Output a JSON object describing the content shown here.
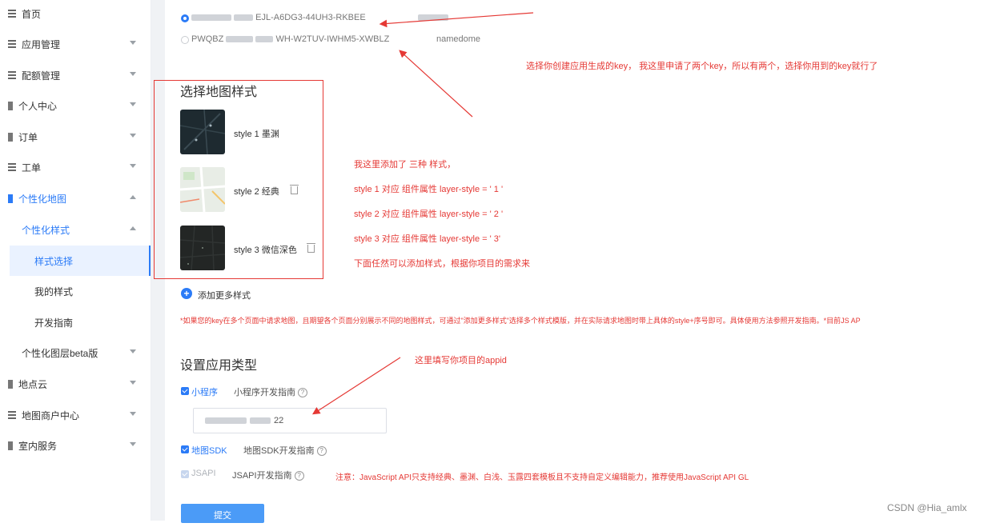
{
  "sidebar": {
    "items": [
      {
        "label": "首页"
      },
      {
        "label": "应用管理"
      },
      {
        "label": "配额管理"
      },
      {
        "label": "个人中心"
      },
      {
        "label": "订单"
      },
      {
        "label": "工单"
      },
      {
        "label": "个性化地图"
      },
      {
        "label": "个性化样式"
      },
      {
        "label": "样式选择"
      },
      {
        "label": "我的样式"
      },
      {
        "label": "开发指南"
      },
      {
        "label": "个性化图层beta版"
      },
      {
        "label": "地点云"
      },
      {
        "label": "地图商户中心"
      },
      {
        "label": "室内服务"
      }
    ]
  },
  "keys": [
    {
      "key_suffix": "EJL-A6DG3-44UH3-RKBEE",
      "name": "",
      "selected": true
    },
    {
      "key_prefix": "PWQBZ",
      "key_suffix": "WH-W2TUV-IWHM5-XWBLZ",
      "name": "namedome",
      "selected": false
    }
  ],
  "style_section": {
    "title": "选择地图样式",
    "styles": [
      {
        "label": "style 1 墨渊"
      },
      {
        "label": "style 2 经典"
      },
      {
        "label": "style 3 微信深色"
      }
    ],
    "add_more": "添加更多样式",
    "note": "*如果您的key在多个页面中请求地图，且期望各个页面分别展示不同的地图样式，可通过\"添加更多样式\"选择多个样式模版，并在实际请求地图时带上具体的style+序号即可。具体使用方法参照开发指南。*目前JS AP"
  },
  "app_type": {
    "title": "设置应用类型",
    "miniprogram": {
      "label": "小程序",
      "guide": "小程序开发指南",
      "appid_suffix": "22"
    },
    "sdk": {
      "label": "地图SDK",
      "guide": "地图SDK开发指南"
    },
    "jsapi": {
      "label": "JSAPI",
      "guide": "JSAPI开发指南"
    },
    "submit": "提交"
  },
  "annotations": {
    "key_note": "选择你创建应用生成的key， 我这里申请了两个key，所以有两个，选择你用到的key就行了",
    "style_note_1": "我这里添加了 三种 样式，",
    "style_note_2": "style 1    对应  组件属性     layer-style = ' 1 '",
    "style_note_3": "style 2     对应  组件属性    layer-style = ' 2 '",
    "style_note_4": "style 3     对应  组件属性   layer-style = ' 3'",
    "style_note_5": "下面任然可以添加样式，根据你项目的需求来",
    "appid_note": "这里填写你项目的appid",
    "jsapi_note": "注意：JavaScript API只支持经典、墨渊、白浅、玉露四套模板且不支持自定义编辑能力，推荐使用JavaScript API GL"
  },
  "watermark": "CSDN @Hia_amlx",
  "colors": {
    "accent": "#2b7bf7",
    "annotation": "#e53935"
  }
}
